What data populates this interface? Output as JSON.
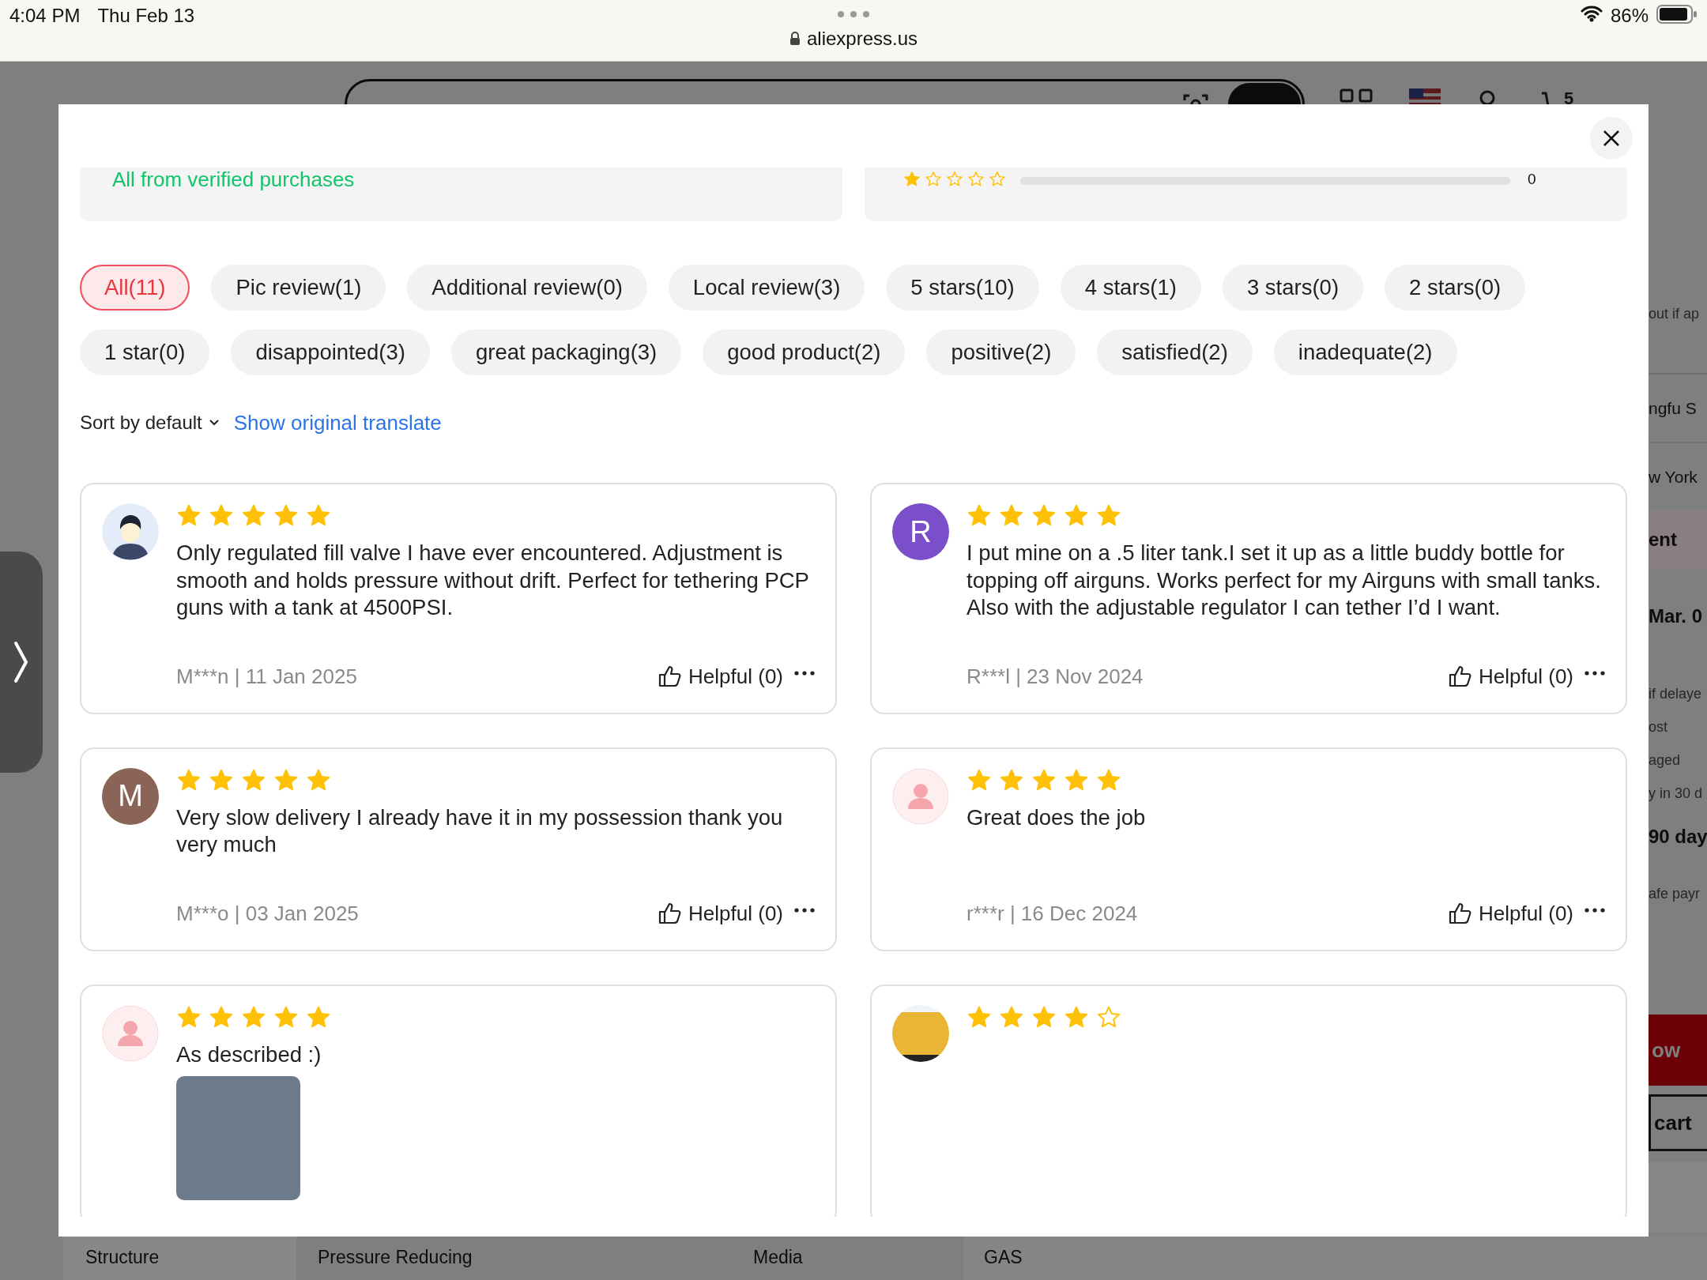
{
  "status_bar": {
    "time": "4:04 PM",
    "date": "Thu Feb 13",
    "url": "aliexpress.us",
    "battery": "86%"
  },
  "background": {
    "cart_count": "5",
    "side_items": [
      {
        "kind": "note",
        "text": "out if ap"
      },
      {
        "kind": "line",
        "text": "ngfu S"
      },
      {
        "kind": "line",
        "text": "w York"
      },
      {
        "kind": "heading",
        "text": "ent"
      },
      {
        "kind": "bold",
        "text": "Mar. 0"
      },
      {
        "kind": "note",
        "text": "if delaye"
      },
      {
        "kind": "note",
        "text": "ost"
      },
      {
        "kind": "note",
        "text": "aged"
      },
      {
        "kind": "note",
        "text": "y in 30 d"
      },
      {
        "kind": "bold",
        "text": "90 day"
      },
      {
        "kind": "note",
        "text": "afe payr"
      },
      {
        "kind": "primary",
        "text": "ow"
      },
      {
        "kind": "outline",
        "text": "cart"
      }
    ],
    "spec_row": [
      "Structure",
      "Pressure Reducing",
      "Media",
      "GAS"
    ]
  },
  "modal": {
    "verified_note": "All from verified purchases",
    "rating_row": {
      "stars": 1,
      "count": "0"
    },
    "filters": [
      {
        "label": "All(11)",
        "selected": true
      },
      {
        "label": "Pic review(1)",
        "selected": false
      },
      {
        "label": "Additional review(0)",
        "selected": false
      },
      {
        "label": "Local review(3)",
        "selected": false
      },
      {
        "label": "5 stars(10)",
        "selected": false
      },
      {
        "label": "4 stars(1)",
        "selected": false
      },
      {
        "label": "3 stars(0)",
        "selected": false
      },
      {
        "label": "2 stars(0)",
        "selected": false
      },
      {
        "label": "1 star(0)",
        "selected": false
      },
      {
        "label": "disappointed(3)",
        "selected": false
      },
      {
        "label": "great packaging(3)",
        "selected": false
      },
      {
        "label": "good product(2)",
        "selected": false
      },
      {
        "label": "positive(2)",
        "selected": false
      },
      {
        "label": "satisfied(2)",
        "selected": false
      },
      {
        "label": "inadequate(2)",
        "selected": false
      }
    ],
    "sort": "Sort by default",
    "translate_link": "Show original translate",
    "reviews": [
      {
        "avatar": {
          "kind": "illustration"
        },
        "stars": 5,
        "text": "Only regulated fill valve I have ever encountered. Adjustment is smooth and holds pressure without drift. Perfect for tethering PCP guns with a tank at 4500PSI.",
        "author_date": "M***n | 11 Jan 2025",
        "helpful": "Helpful (0)",
        "has_photo": false
      },
      {
        "avatar": {
          "kind": "letter",
          "letter": "R",
          "color": "#7b4fc9"
        },
        "stars": 5,
        "text": "I put mine on a .5 liter tank.I set it up as a little buddy bottle for topping off airguns. Works perfect for my Airguns with small tanks. Also with the adjustable regulator I can tether I’d I want.",
        "author_date": "R***l | 23 Nov 2024",
        "helpful": "Helpful (0)",
        "has_photo": false
      },
      {
        "avatar": {
          "kind": "letter",
          "letter": "M",
          "color": "#8b6458"
        },
        "stars": 5,
        "text": "Very slow delivery I already have it in my possession thank you very much",
        "author_date": "M***o | 03 Jan 2025",
        "helpful": "Helpful (0)",
        "has_photo": false
      },
      {
        "avatar": {
          "kind": "placeholder"
        },
        "stars": 5,
        "text": "Great does the job",
        "author_date": "r***r | 16 Dec 2024",
        "helpful": "Helpful (0)",
        "has_photo": false
      },
      {
        "avatar": {
          "kind": "placeholder"
        },
        "stars": 5,
        "text": "As described :)",
        "has_photo": true
      },
      {
        "avatar": {
          "kind": "photo"
        },
        "stars": 4,
        "has_photo": false
      }
    ]
  }
}
